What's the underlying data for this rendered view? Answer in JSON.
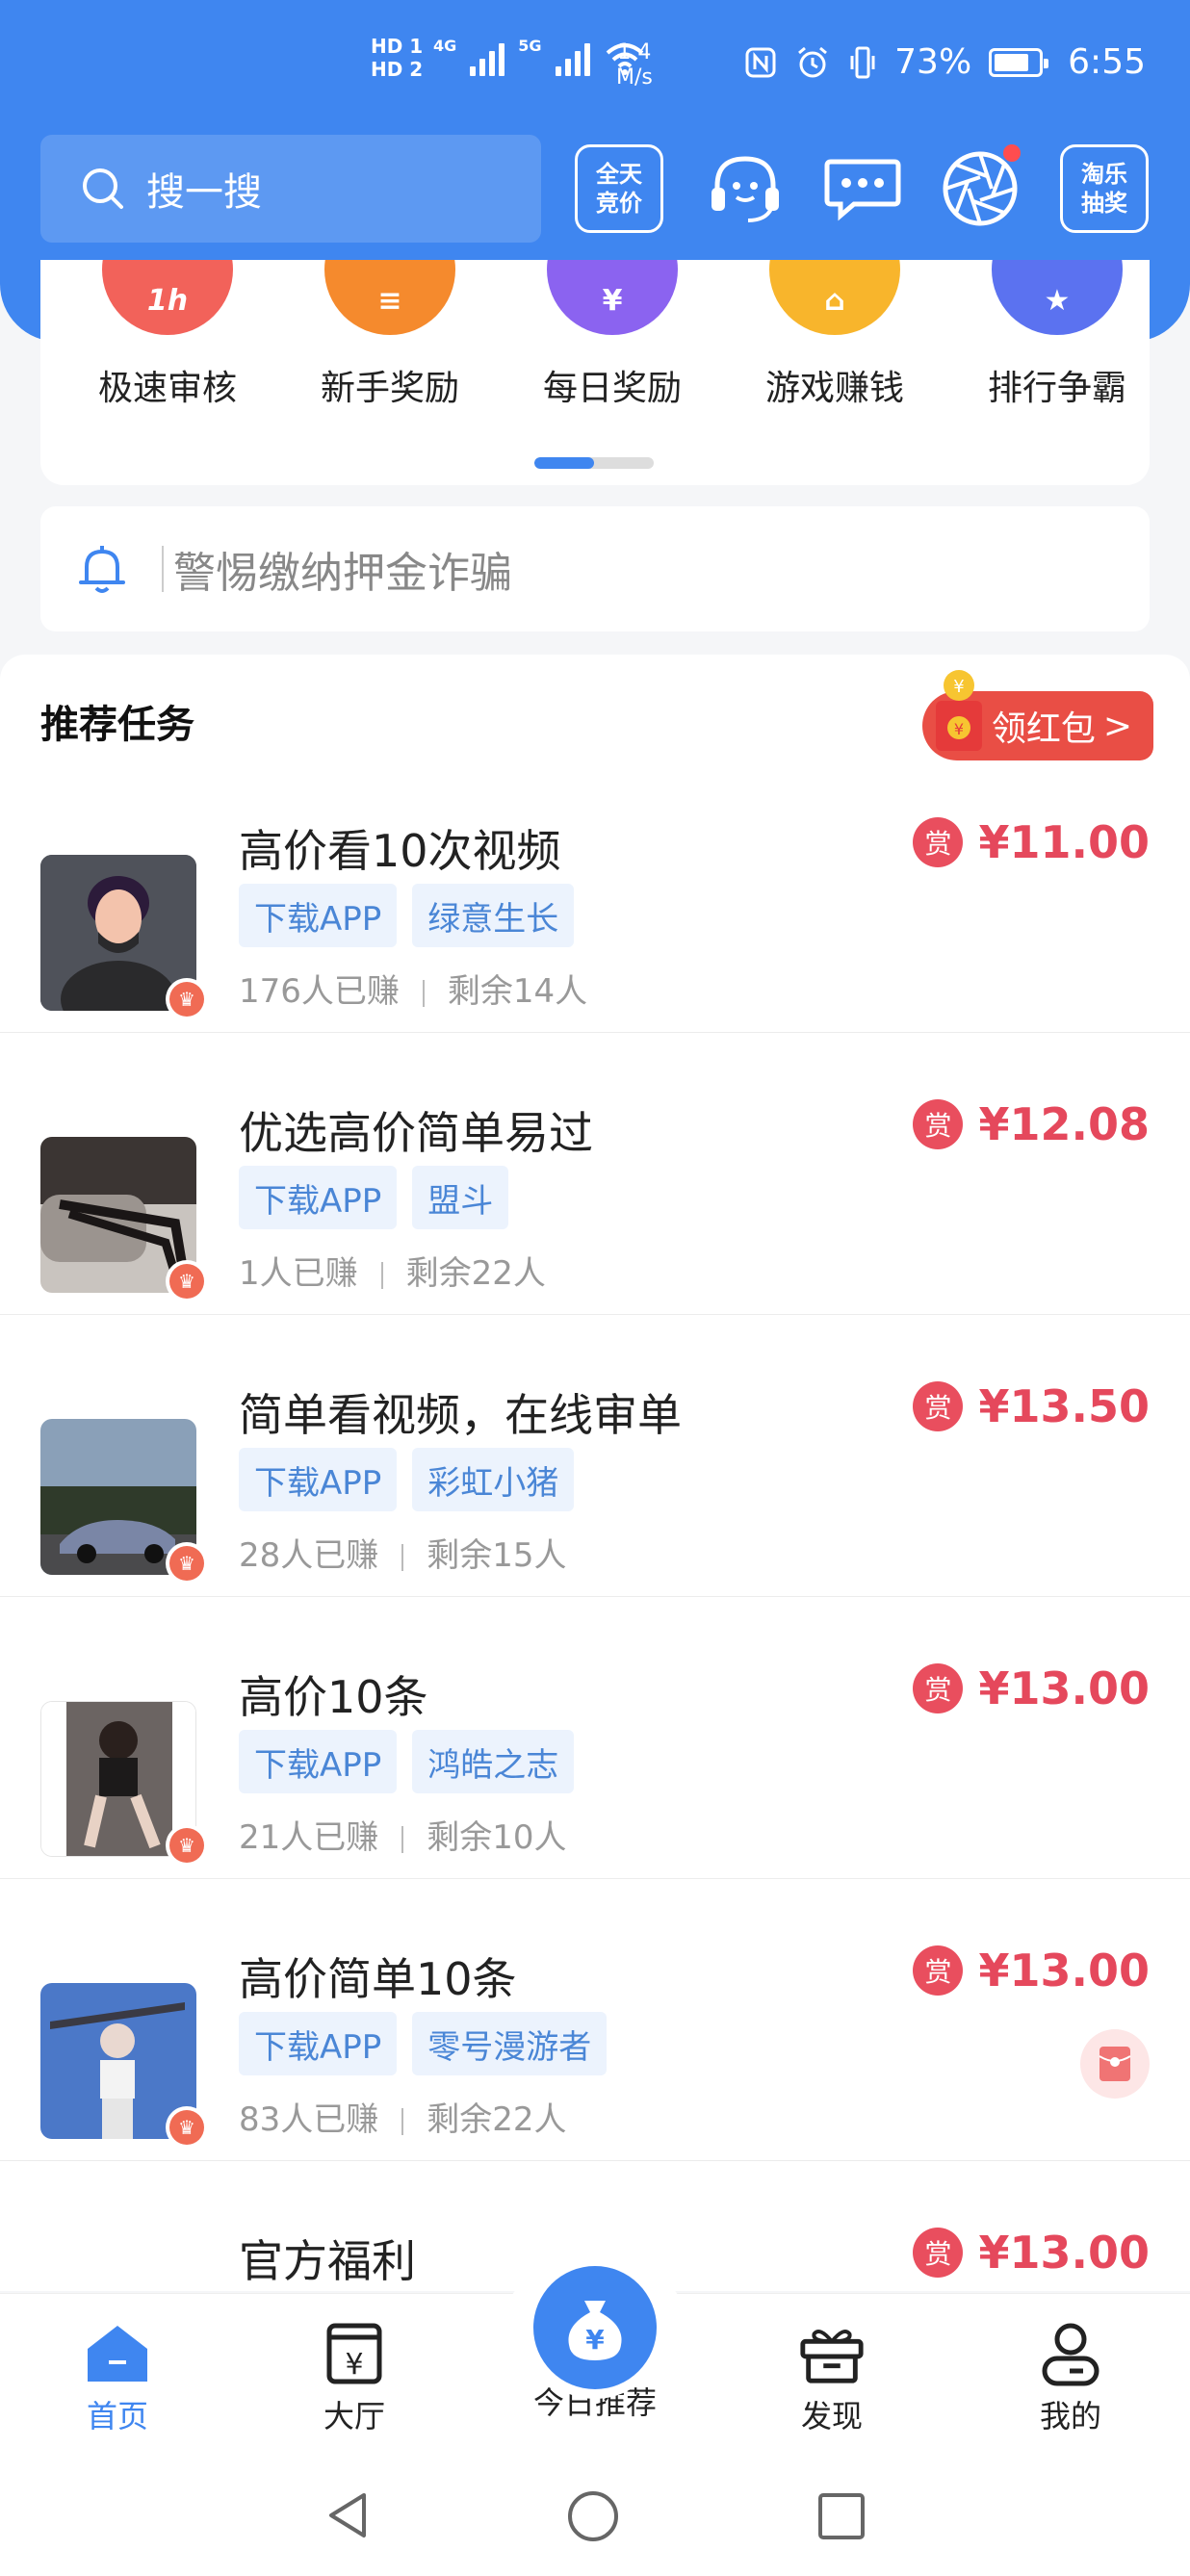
{
  "status_bar": {
    "hd_labels": [
      "HD 1",
      "HD 2"
    ],
    "network": [
      "4G",
      "5G"
    ],
    "speed_value": "1.4",
    "speed_unit": "M/s",
    "battery": "73%",
    "time": "6:55"
  },
  "header": {
    "search_placeholder": "搜一搜",
    "bid_button": [
      "全天",
      "竞价"
    ],
    "lottery_button": [
      "淘乐",
      "抽奖"
    ]
  },
  "categories": [
    {
      "label": "极速审核",
      "badge": "1h",
      "color": "#f2625a"
    },
    {
      "label": "新手奖励",
      "badge": "≡",
      "color": "#f58a2d"
    },
    {
      "label": "每日奖励",
      "badge": "¥",
      "color": "#8b63f0"
    },
    {
      "label": "游戏赚钱",
      "badge": "⌂",
      "color": "#f8b52c"
    },
    {
      "label": "排行争霸",
      "badge": "★",
      "color": "#5b72f0"
    }
  ],
  "notice": {
    "text": "警惕缴纳押金诈骗"
  },
  "section": {
    "title": "推荐任务",
    "red_packet_label": "领红包",
    "red_packet_arrow": ">"
  },
  "tasks": [
    {
      "title": "高价看10次视频",
      "tags": [
        "下载APP",
        "绿意生长"
      ],
      "earned": "176人已赚",
      "remaining": "剩余14人",
      "price": "¥11.00",
      "reward_label": "赏"
    },
    {
      "title": "优选高价简单易过",
      "tags": [
        "下载APP",
        "盟斗"
      ],
      "earned": "1人已赚",
      "remaining": "剩余22人",
      "price": "¥12.08",
      "reward_label": "赏"
    },
    {
      "title": "简单看视频，在线审单",
      "tags": [
        "下载APP",
        "彩虹小猪"
      ],
      "earned": "28人已赚",
      "remaining": "剩余15人",
      "price": "¥13.50",
      "reward_label": "赏"
    },
    {
      "title": "高价10条",
      "tags": [
        "下载APP",
        "鸿皓之志"
      ],
      "earned": "21人已赚",
      "remaining": "剩余10人",
      "price": "¥13.00",
      "reward_label": "赏"
    },
    {
      "title": "高价简单10条",
      "tags": [
        "下载APP",
        "零号漫游者"
      ],
      "earned": "83人已赚",
      "remaining": "剩余22人",
      "price": "¥13.00",
      "reward_label": "赏"
    },
    {
      "title": "官方福利",
      "tags": [],
      "earned": "",
      "remaining": "",
      "price": "¥13.00",
      "reward_label": "赏"
    }
  ],
  "tabs": [
    {
      "label": "首页",
      "icon": "home-icon",
      "active": true
    },
    {
      "label": "大厅",
      "icon": "hall-icon"
    },
    {
      "label": "今日推荐",
      "icon": "money-bag-icon"
    },
    {
      "label": "发现",
      "icon": "gift-box-icon"
    },
    {
      "label": "我的",
      "icon": "profile-icon"
    }
  ],
  "colors": {
    "primary": "#3f86f0",
    "price": "#e5485c"
  }
}
